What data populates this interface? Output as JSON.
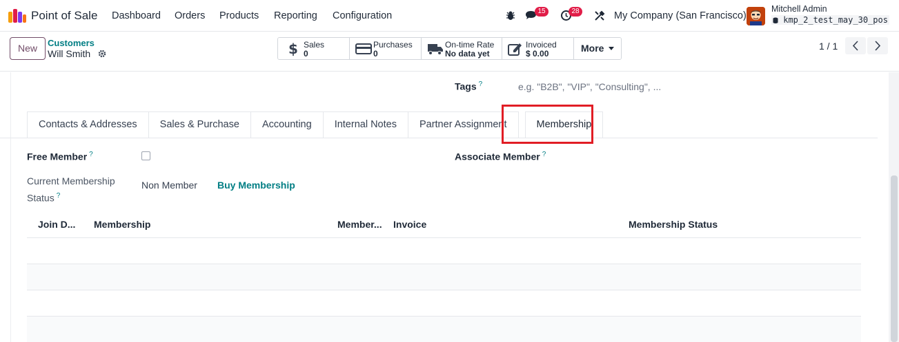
{
  "navbar": {
    "app_name": "Point of Sale",
    "menu": [
      "Dashboard",
      "Orders",
      "Products",
      "Reporting",
      "Configuration"
    ],
    "messages_count": "15",
    "activities_count": "28",
    "company": "My Company (San Francisco)",
    "user_name": "Mitchell Admin",
    "database": "kmp_2_test_may_30_pos",
    "icons": [
      "bug-icon",
      "chat-icon",
      "clock-icon",
      "tools-icon"
    ]
  },
  "control": {
    "new_label": "New",
    "breadcrumb_parent": "Customers",
    "breadcrumb_current": "Will Smith",
    "smart_buttons": [
      {
        "label": "Sales",
        "value": "0",
        "icon": "dollar-icon"
      },
      {
        "label": "Purchases",
        "value": "0",
        "icon": "credit-card-icon"
      },
      {
        "label": "On-time Rate",
        "value": "No data yet",
        "icon": "truck-icon"
      },
      {
        "label": "Invoiced",
        "value": "$ 0.00",
        "icon": "pencil-square-icon"
      }
    ],
    "more_label": "More",
    "pager": "1 / 1"
  },
  "form": {
    "tags_label": "Tags",
    "tags_placeholder": "e.g. \"B2B\", \"VIP\", \"Consulting\", ...",
    "help_mark": "?",
    "tabs": [
      "Contacts & Addresses",
      "Sales & Purchase",
      "Accounting",
      "Internal Notes",
      "Partner Assignment",
      "Membership"
    ],
    "active_tab": "Membership",
    "free_member_label": "Free Member",
    "free_member_checked": false,
    "associate_member_label": "Associate Member",
    "current_status_label_line1": "Current Membership",
    "current_status_label_line2": "Status",
    "current_status_value": "Non Member",
    "buy_membership_label": "Buy Membership"
  },
  "membership_table": {
    "columns": [
      "Join D...",
      "Membership",
      "Member...",
      "Invoice",
      "Membership Status"
    ],
    "rows": []
  },
  "colors": {
    "brand": "#714b67",
    "link": "#017e84",
    "badge": "#e11d48",
    "highlight": "#e11d25"
  }
}
